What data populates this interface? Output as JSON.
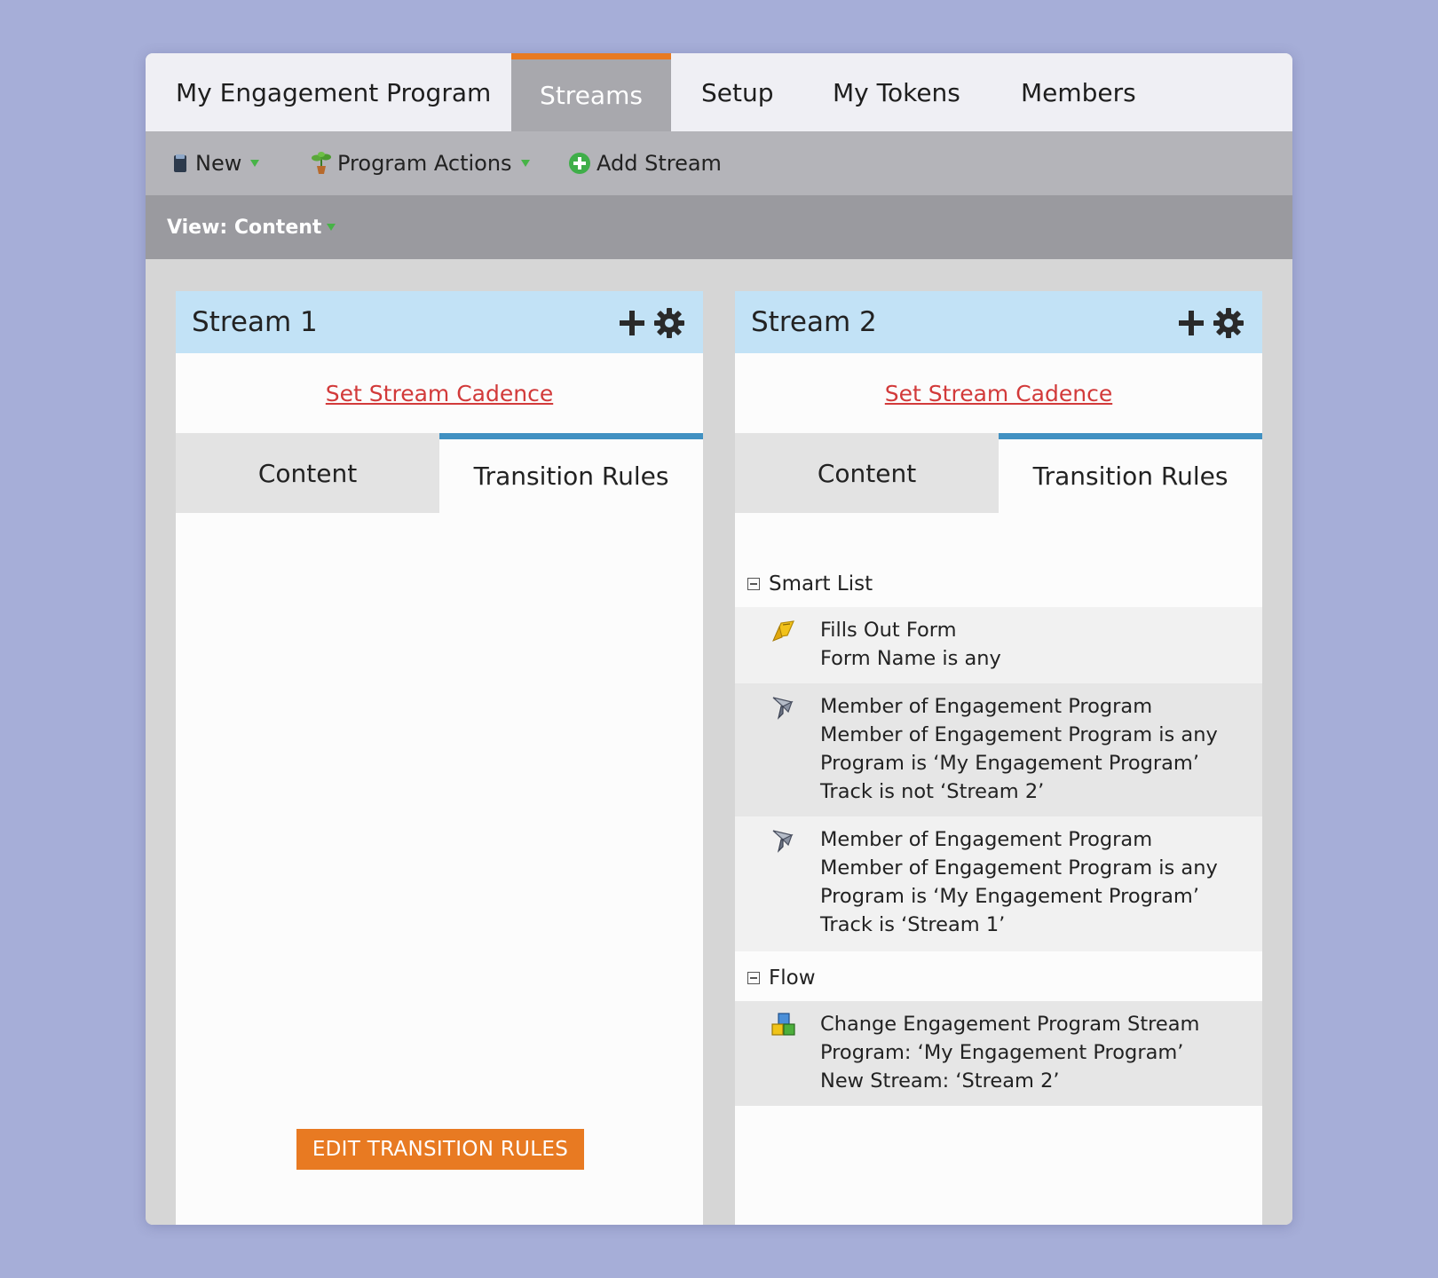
{
  "tabs": [
    {
      "label": "My Engagement Program",
      "active": false
    },
    {
      "label": "Streams",
      "active": true
    },
    {
      "label": "Setup",
      "active": false
    },
    {
      "label": "My Tokens",
      "active": false
    },
    {
      "label": "Members",
      "active": false
    }
  ],
  "toolbar": {
    "new_label": "New",
    "program_actions_label": "Program Actions",
    "add_stream_label": "Add Stream"
  },
  "view": {
    "label": "View: Content"
  },
  "colors": {
    "accent": "#e87a22",
    "tab_active_bg": "#a8a8ad",
    "stream_header": "#c2e2f6",
    "link": "#d23a3a",
    "rules_tab_accent": "#4191c2"
  },
  "streams": [
    {
      "title": "Stream 1",
      "cadence_link": "Set Stream Cadence",
      "subtabs": {
        "content": "Content",
        "rules": "Transition Rules"
      },
      "edit_button": "EDIT TRANSITION RULES"
    },
    {
      "title": "Stream 2",
      "cadence_link": "Set Stream Cadence",
      "subtabs": {
        "content": "Content",
        "rules": "Transition Rules"
      },
      "smart_list": {
        "heading": "Smart List",
        "rules": [
          {
            "icon": "form-icon",
            "line1": "Fills Out Form",
            "line2": "Form Name is any"
          },
          {
            "icon": "filter-icon",
            "line1": "Member of Engagement Program",
            "line2": "Member of Engagement Program is any",
            "line3": "Program is ‘My Engagement Program’",
            "line4": "Track is not ‘Stream 2’"
          },
          {
            "icon": "filter-icon",
            "line1": "Member of Engagement Program",
            "line2": "Member of Engagement Program is any",
            "line3": "Program is ‘My Engagement Program’",
            "line4": "Track is ‘Stream 1’"
          }
        ]
      },
      "flow": {
        "heading": "Flow",
        "steps": [
          {
            "icon": "flow-step-icon",
            "line1": "Change Engagement Program Stream",
            "line2": "Program: ‘My Engagement Program’",
            "line3": "New Stream: ‘Stream 2’"
          }
        ]
      }
    }
  ]
}
